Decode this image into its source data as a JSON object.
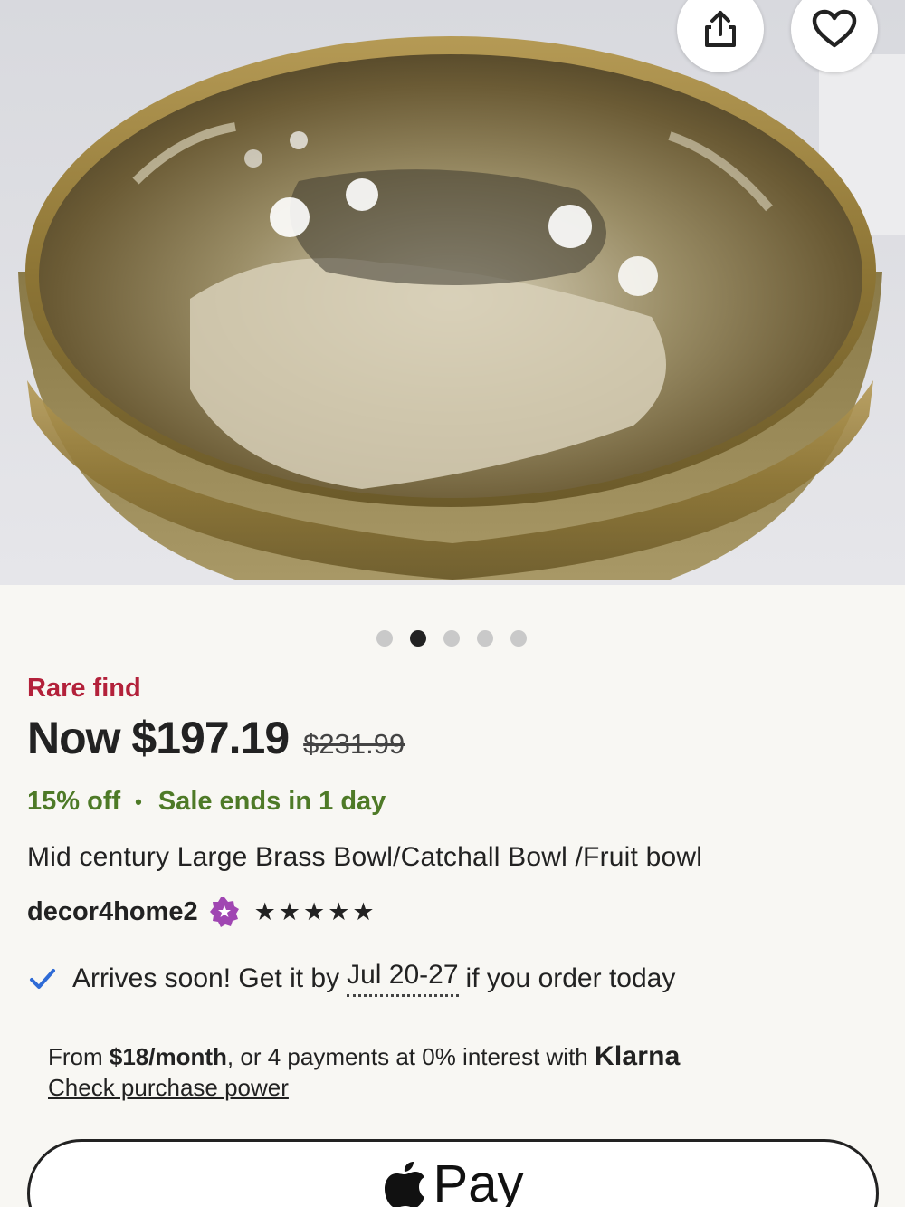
{
  "hero": {
    "image_alt": "Brass bowl product photo",
    "share_icon": "share-icon",
    "favorite_icon": "heart-icon"
  },
  "carousel": {
    "count": 5,
    "active_index": 1
  },
  "badge": "Rare find",
  "price": {
    "now": "Now $197.19",
    "was": "$231.99"
  },
  "sale": {
    "discount": "15% off",
    "separator": "•",
    "ends": "Sale ends in 1 day"
  },
  "listing_title": "Mid century Large Brass Bowl/Catchall Bowl /Fruit bowl",
  "shop": {
    "name": "decor4home2",
    "star_seller_icon": "star-seller-icon",
    "rating_stars": "★★★★★",
    "rating_value": 5
  },
  "delivery": {
    "prefix": "Arrives soon! Get it by",
    "date": "Jul 20-27",
    "suffix": "if you order today"
  },
  "klarna": {
    "from": "From ",
    "amount": "$18/month",
    "rest": ", or 4 payments at 0% interest with ",
    "brand": "Klarna",
    "link": "Check purchase power"
  },
  "apple_pay": {
    "label": "Pay"
  },
  "colors": {
    "sale_red": "#b3213a",
    "sale_green": "#4e7a27",
    "star_seller_purple": "#a046b2",
    "check_blue": "#2f6bd6"
  }
}
